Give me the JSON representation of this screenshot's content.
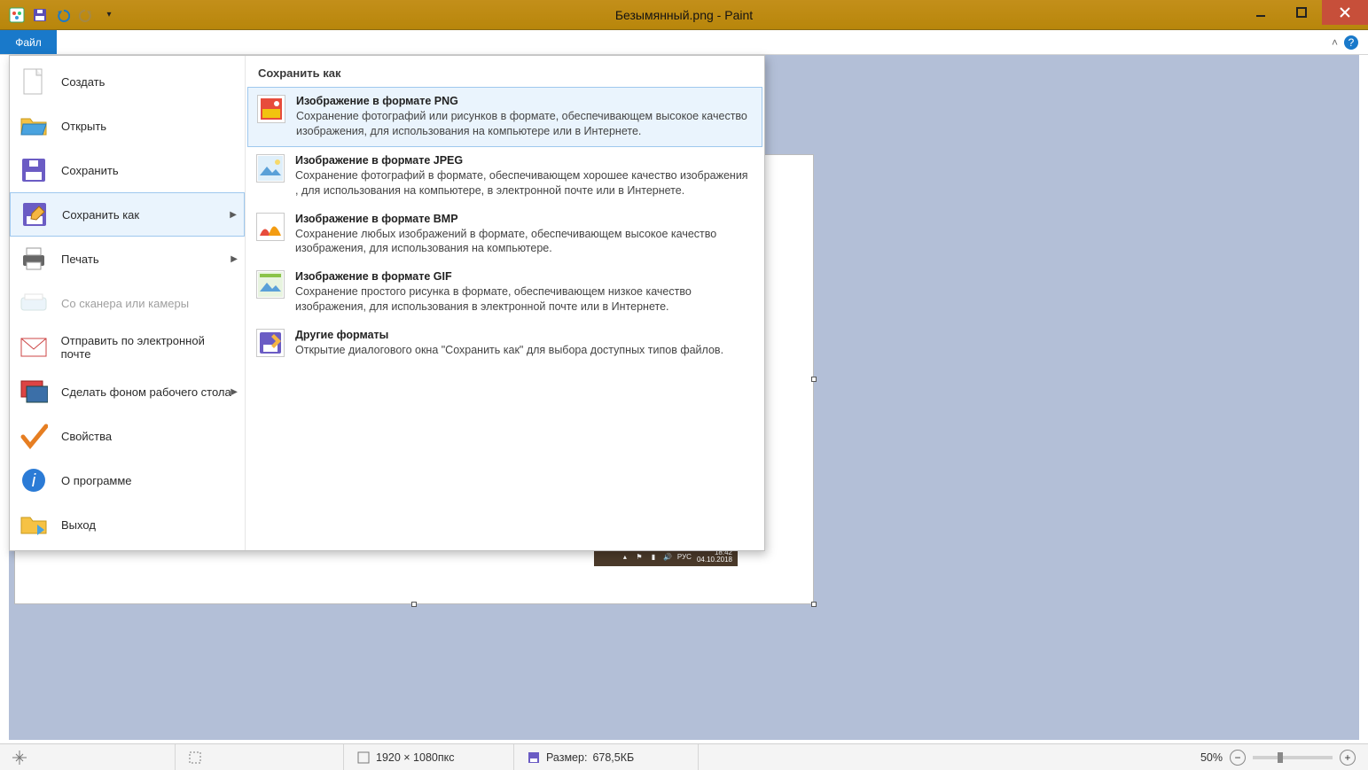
{
  "window": {
    "title": "Безымянный.png - Paint"
  },
  "tabs": {
    "file": "Файл"
  },
  "backstage": {
    "items": [
      {
        "label": "Создать",
        "arrow": false
      },
      {
        "label": "Открыть",
        "arrow": false
      },
      {
        "label": "Сохранить",
        "arrow": false
      },
      {
        "label": "Сохранить как",
        "arrow": true,
        "selected": true
      },
      {
        "label": "Печать",
        "arrow": true
      },
      {
        "label": "Со сканера или камеры",
        "arrow": false,
        "disabled": true
      },
      {
        "label": "Отправить по электронной почте",
        "arrow": false
      },
      {
        "label": "Сделать фоном рабочего стола",
        "arrow": true
      },
      {
        "label": "Свойства",
        "arrow": false
      },
      {
        "label": "О программе",
        "arrow": false
      },
      {
        "label": "Выход",
        "arrow": false
      }
    ],
    "submenu_title": "Сохранить как",
    "options": [
      {
        "title": "Изображение в формате PNG",
        "desc": "Сохранение фотографий или рисунков в формате, обеспечивающем высокое качество изображения, для использования на компьютере или в Интернете.",
        "highlight": true
      },
      {
        "title": "Изображение в формате JPEG",
        "desc": "Сохранение фотографий в формате, обеспечивающем хорошее качество изображения , для использования на компьютере, в электронной почте или в Интернете."
      },
      {
        "title": "Изображение в формате BMP",
        "desc": "Сохранение любых изображений в формате, обеспечивающем высокое качество изображения, для использования на компьютере."
      },
      {
        "title": "Изображение в формате GIF",
        "desc": "Сохранение простого рисунка в формате, обеспечивающем низкое качество изображения, для использования в электронной почте или в Интернете."
      },
      {
        "title": "Другие форматы",
        "desc": "Открытие диалогового окна \"Сохранить как\" для выбора доступных типов файлов."
      }
    ]
  },
  "taskbar_thumb": {
    "lang": "РУС",
    "time": "18:42",
    "date": "04.10.2018"
  },
  "status": {
    "dimensions": "1920 × 1080пкс",
    "size_label": "Размер:",
    "size_value": "678,5КБ",
    "zoom": "50%"
  }
}
